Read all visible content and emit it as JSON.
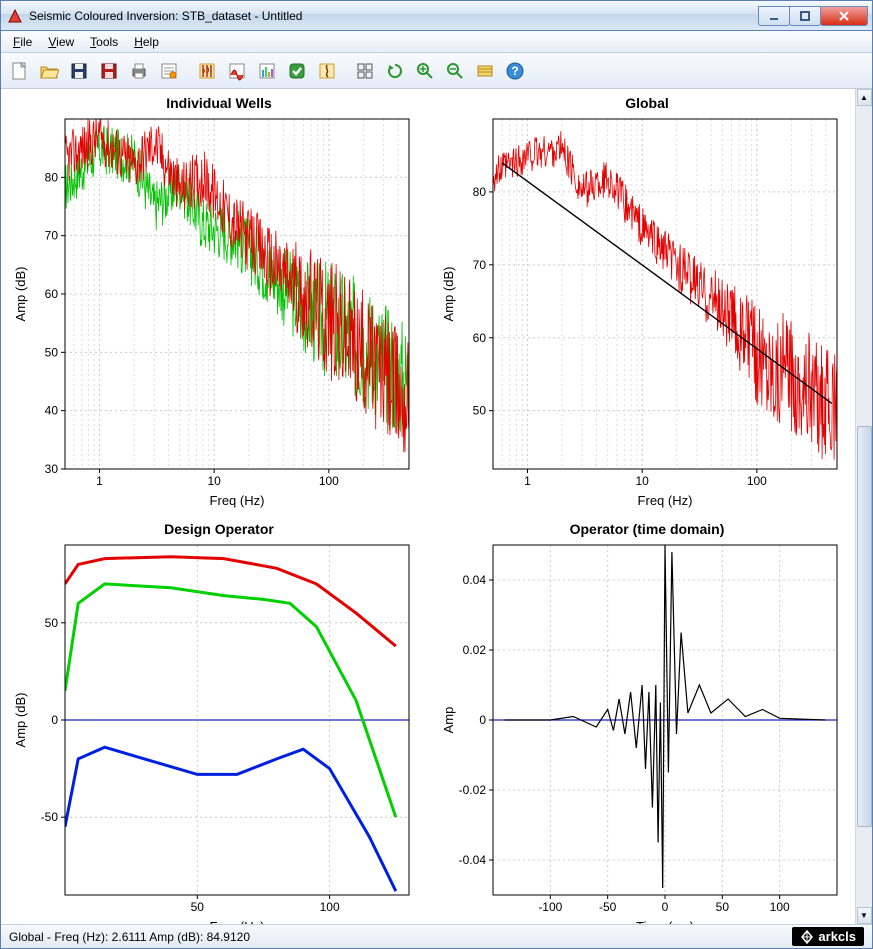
{
  "window": {
    "title": "Seismic Coloured Inversion: STB_dataset - Untitled"
  },
  "menu": {
    "file": "File",
    "view": "View",
    "tools": "Tools",
    "help": "Help"
  },
  "toolbar_icons": [
    "new-file",
    "open-file",
    "save",
    "save-alt",
    "print",
    "properties",
    "sep",
    "well-red",
    "well-red2",
    "bars",
    "check",
    "curve",
    "sep",
    "grid4",
    "refresh",
    "zoom-in",
    "zoom-out",
    "fit",
    "help"
  ],
  "status": {
    "text": "Global  -  Freq (Hz): 2.6111  Amp (dB): 84.9120",
    "brand": "arkcls"
  },
  "chart_data": [
    {
      "id": "individual-wells",
      "title": "Individual Wells",
      "type": "line",
      "xlabel": "Freq (Hz)",
      "ylabel": "Amp (dB)",
      "xscale": "log",
      "xlim": [
        0.5,
        500
      ],
      "ylim": [
        30,
        90
      ],
      "xticks": [
        1,
        10,
        100
      ],
      "yticks": [
        30,
        40,
        50,
        60,
        70,
        80
      ],
      "series": [
        {
          "name": "well-red",
          "color": "#e40000"
        },
        {
          "name": "well-green",
          "color": "#00c000"
        }
      ],
      "approx_trend_red": [
        [
          0.6,
          84
        ],
        [
          1,
          87
        ],
        [
          2,
          82
        ],
        [
          3,
          86
        ],
        [
          5,
          78
        ],
        [
          8,
          80
        ],
        [
          15,
          72
        ],
        [
          30,
          66
        ],
        [
          60,
          60
        ],
        [
          120,
          54
        ],
        [
          250,
          48
        ],
        [
          450,
          42
        ]
      ],
      "approx_trend_green": [
        [
          0.6,
          80
        ],
        [
          1,
          85
        ],
        [
          2,
          83
        ],
        [
          3,
          75
        ],
        [
          5,
          79
        ],
        [
          8,
          72
        ],
        [
          15,
          70
        ],
        [
          30,
          64
        ],
        [
          60,
          58
        ],
        [
          120,
          54
        ],
        [
          250,
          50
        ],
        [
          450,
          45
        ]
      ]
    },
    {
      "id": "global",
      "title": "Global",
      "type": "line",
      "xlabel": "Freq (Hz)",
      "ylabel": "Amp (dB)",
      "xscale": "log",
      "xlim": [
        0.5,
        500
      ],
      "ylim": [
        42,
        90
      ],
      "xticks": [
        1,
        10,
        100
      ],
      "yticks": [
        50,
        60,
        70,
        80
      ],
      "series": [
        {
          "name": "signal",
          "color": "#e40000"
        },
        {
          "name": "fit",
          "color": "#000000"
        }
      ],
      "approx_trend_red": [
        [
          0.6,
          83
        ],
        [
          1,
          85
        ],
        [
          2,
          86
        ],
        [
          3,
          80
        ],
        [
          5,
          82
        ],
        [
          10,
          75
        ],
        [
          20,
          70
        ],
        [
          50,
          64
        ],
        [
          100,
          58
        ],
        [
          200,
          55
        ],
        [
          450,
          50
        ]
      ],
      "fit_line": [
        [
          0.6,
          84
        ],
        [
          450,
          51
        ]
      ]
    },
    {
      "id": "design-operator",
      "title": "Design Operator",
      "type": "line",
      "xlabel": "Freq (Hz)",
      "ylabel": "Amp (dB)",
      "xlim": [
        0,
        130
      ],
      "ylim": [
        -90,
        90
      ],
      "xticks": [
        50,
        100
      ],
      "yticks": [
        -50,
        0,
        50
      ],
      "series": [
        {
          "name": "red",
          "color": "#e40000",
          "values": [
            [
              0,
              70
            ],
            [
              5,
              80
            ],
            [
              15,
              83
            ],
            [
              40,
              84
            ],
            [
              60,
              83
            ],
            [
              80,
              78
            ],
            [
              95,
              70
            ],
            [
              110,
              55
            ],
            [
              125,
              38
            ]
          ]
        },
        {
          "name": "green",
          "color": "#00d000",
          "values": [
            [
              0,
              15
            ],
            [
              5,
              60
            ],
            [
              15,
              70
            ],
            [
              40,
              68
            ],
            [
              60,
              64
            ],
            [
              75,
              62
            ],
            [
              85,
              60
            ],
            [
              95,
              48
            ],
            [
              110,
              10
            ],
            [
              125,
              -50
            ]
          ]
        },
        {
          "name": "blue",
          "color": "#0020e0",
          "values": [
            [
              0,
              -55
            ],
            [
              5,
              -20
            ],
            [
              15,
              -14
            ],
            [
              30,
              -20
            ],
            [
              50,
              -28
            ],
            [
              65,
              -28
            ],
            [
              80,
              -20
            ],
            [
              90,
              -15
            ],
            [
              100,
              -25
            ],
            [
              115,
              -60
            ],
            [
              125,
              -88
            ]
          ]
        }
      ],
      "zero_line": true
    },
    {
      "id": "operator-time",
      "title": "Operator (time domain)",
      "type": "line",
      "xlabel": "Time (ms)",
      "ylabel": "Amp",
      "xlim": [
        -150,
        150
      ],
      "ylim": [
        -0.05,
        0.05
      ],
      "xticks": [
        -100,
        -50,
        0,
        50,
        100
      ],
      "yticks": [
        -0.04,
        -0.02,
        0,
        0.02,
        0.04
      ],
      "series": [
        {
          "name": "operator",
          "color": "#000000",
          "values": [
            [
              -140,
              0
            ],
            [
              -100,
              0
            ],
            [
              -80,
              0.001
            ],
            [
              -60,
              -0.002
            ],
            [
              -50,
              0.003
            ],
            [
              -45,
              -0.003
            ],
            [
              -40,
              0.006
            ],
            [
              -35,
              -0.004
            ],
            [
              -30,
              0.008
            ],
            [
              -25,
              -0.008
            ],
            [
              -20,
              0.01
            ],
            [
              -17,
              -0.014
            ],
            [
              -14,
              0.008
            ],
            [
              -11,
              -0.025
            ],
            [
              -8,
              0.01
            ],
            [
              -6,
              -0.035
            ],
            [
              -4,
              0.005
            ],
            [
              -2,
              -0.048
            ],
            [
              0,
              0.05
            ],
            [
              3,
              -0.015
            ],
            [
              6,
              0.048
            ],
            [
              10,
              -0.004
            ],
            [
              14,
              0.025
            ],
            [
              20,
              0.002
            ],
            [
              30,
              0.01
            ],
            [
              40,
              0.002
            ],
            [
              55,
              0.006
            ],
            [
              70,
              0.001
            ],
            [
              85,
              0.003
            ],
            [
              100,
              0.0005
            ],
            [
              140,
              0
            ]
          ]
        }
      ],
      "zero_line": true
    }
  ]
}
